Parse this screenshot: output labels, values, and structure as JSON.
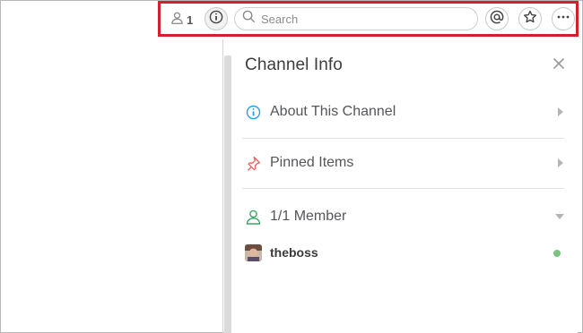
{
  "toolbar": {
    "member_count": "1",
    "search": {
      "placeholder": "Search",
      "value": ""
    },
    "icons": [
      "person-icon",
      "info-icon",
      "search-icon",
      "at-icon",
      "star-icon",
      "more-icon"
    ]
  },
  "panel": {
    "title": "Channel Info",
    "sections": [
      {
        "label": "About This Channel",
        "icon": "info-icon",
        "icon_color": "#2d9ee0",
        "state": "collapsed"
      },
      {
        "label": "Pinned Items",
        "icon": "pin-icon",
        "icon_color": "#e8615c",
        "state": "collapsed"
      },
      {
        "label": "1/1 Member",
        "icon": "person-icon",
        "icon_color": "#39a564",
        "state": "expanded"
      }
    ],
    "members": [
      {
        "name": "theboss",
        "status": "online"
      }
    ]
  },
  "colors": {
    "highlight_border": "#d4202c",
    "online": "#7bc47f",
    "caret": "#b5b5b5"
  }
}
